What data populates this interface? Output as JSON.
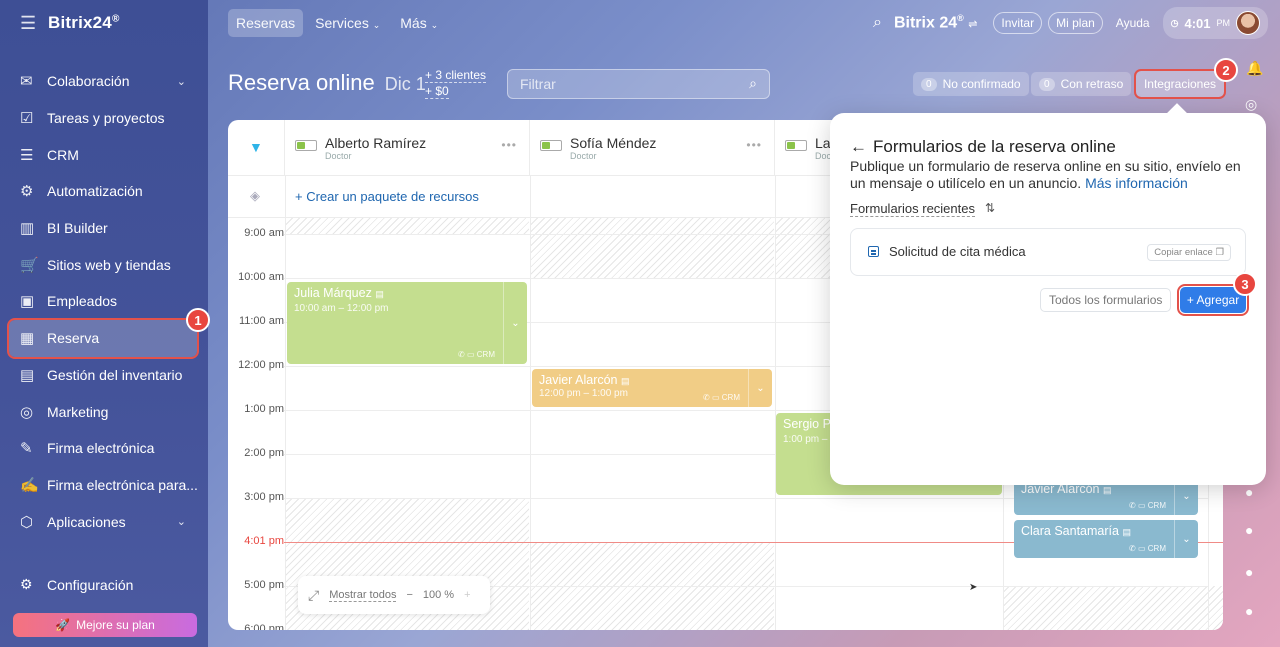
{
  "sidebar": {
    "logo": "Bitrix24",
    "logo_mark": "®",
    "items": [
      {
        "label": "Colaboración",
        "icon": "chat-icon",
        "chevron": true
      },
      {
        "label": "Tareas y proyectos",
        "icon": "checkbox-icon"
      },
      {
        "label": "CRM",
        "icon": "funnel-icon"
      },
      {
        "label": "Automatización",
        "icon": "robot-icon"
      },
      {
        "label": "BI Builder",
        "icon": "bar-chart-icon"
      },
      {
        "label": "Sitios web y tiendas",
        "icon": "cart-icon"
      },
      {
        "label": "Empleados",
        "icon": "id-card-icon"
      },
      {
        "label": "Reserva",
        "icon": "calendar-icon",
        "active": true
      },
      {
        "label": "Gestión del inventario",
        "icon": "box-icon"
      },
      {
        "label": "Marketing",
        "icon": "target-icon"
      },
      {
        "label": "Firma electrónica",
        "icon": "pen-icon"
      },
      {
        "label": "Firma electrónica para...",
        "icon": "document-pen-icon"
      },
      {
        "label": "Aplicaciones",
        "icon": "apps-icon",
        "chevron": true
      }
    ],
    "config_label": "Configuración",
    "upgrade_label": "Mejore su plan"
  },
  "topbar": {
    "tabs": [
      "Reservas",
      "Services",
      "Más"
    ],
    "brand": "Bitrix 24",
    "invite": "Invitar",
    "plan": "Mi plan",
    "help": "Ayuda",
    "time": "4:01",
    "ampm": "PM"
  },
  "header": {
    "title": "Reserva online",
    "date": "Dic 1",
    "clients": "+ 3 clientes",
    "amount": "+ $0",
    "filter_placeholder": "Filtrar",
    "unconfirmed_count": "0",
    "unconfirmed_label": "No confirmado",
    "late_count": "0",
    "late_label": "Con retraso",
    "integrations": "Integraciones"
  },
  "calendar": {
    "resources": [
      {
        "name": "Alberto Ramírez",
        "role": "Doctor"
      },
      {
        "name": "Sofía Méndez",
        "role": "Doctor"
      },
      {
        "name": "La",
        "role": "Doc"
      }
    ],
    "create_package": "+ Crear un paquete de recursos",
    "times": [
      "9:00 am",
      "10:00 am",
      "11:00 am",
      "12:00 pm",
      "1:00 pm",
      "2:00 pm",
      "3:00 pm",
      "4:01 pm",
      "5:00 pm",
      "6:00 pm"
    ],
    "events": [
      {
        "name": "Julia Márquez",
        "time": "10:00 am – 12:00 pm",
        "tag": "CRM"
      },
      {
        "name": "Javier Alarcón",
        "time": "12:00 pm – 1:00 pm",
        "tag": "CRM"
      },
      {
        "name": "Sergio P",
        "time": "1:00 pm –"
      },
      {
        "name": "Javier Alarcón",
        "tag": "CRM"
      },
      {
        "name": "Clara Santamaría",
        "tag": "CRM"
      }
    ],
    "show_all": "Mostrar todos",
    "zoom": "100 %"
  },
  "popup": {
    "title": "Formularios de la reserva online",
    "desc": "Publique un formulario de reserva online en su sitio, envíelo en un mensaje o utilícelo en un anuncio.",
    "more_link": "Más información",
    "recent": "Formularios recientes",
    "form_name": "Solicitud de cita médica",
    "copy_link": "Copiar enlace",
    "all_forms": "Todos los formularios",
    "add": "+ Agregar"
  },
  "badges": [
    "1",
    "2",
    "3"
  ]
}
